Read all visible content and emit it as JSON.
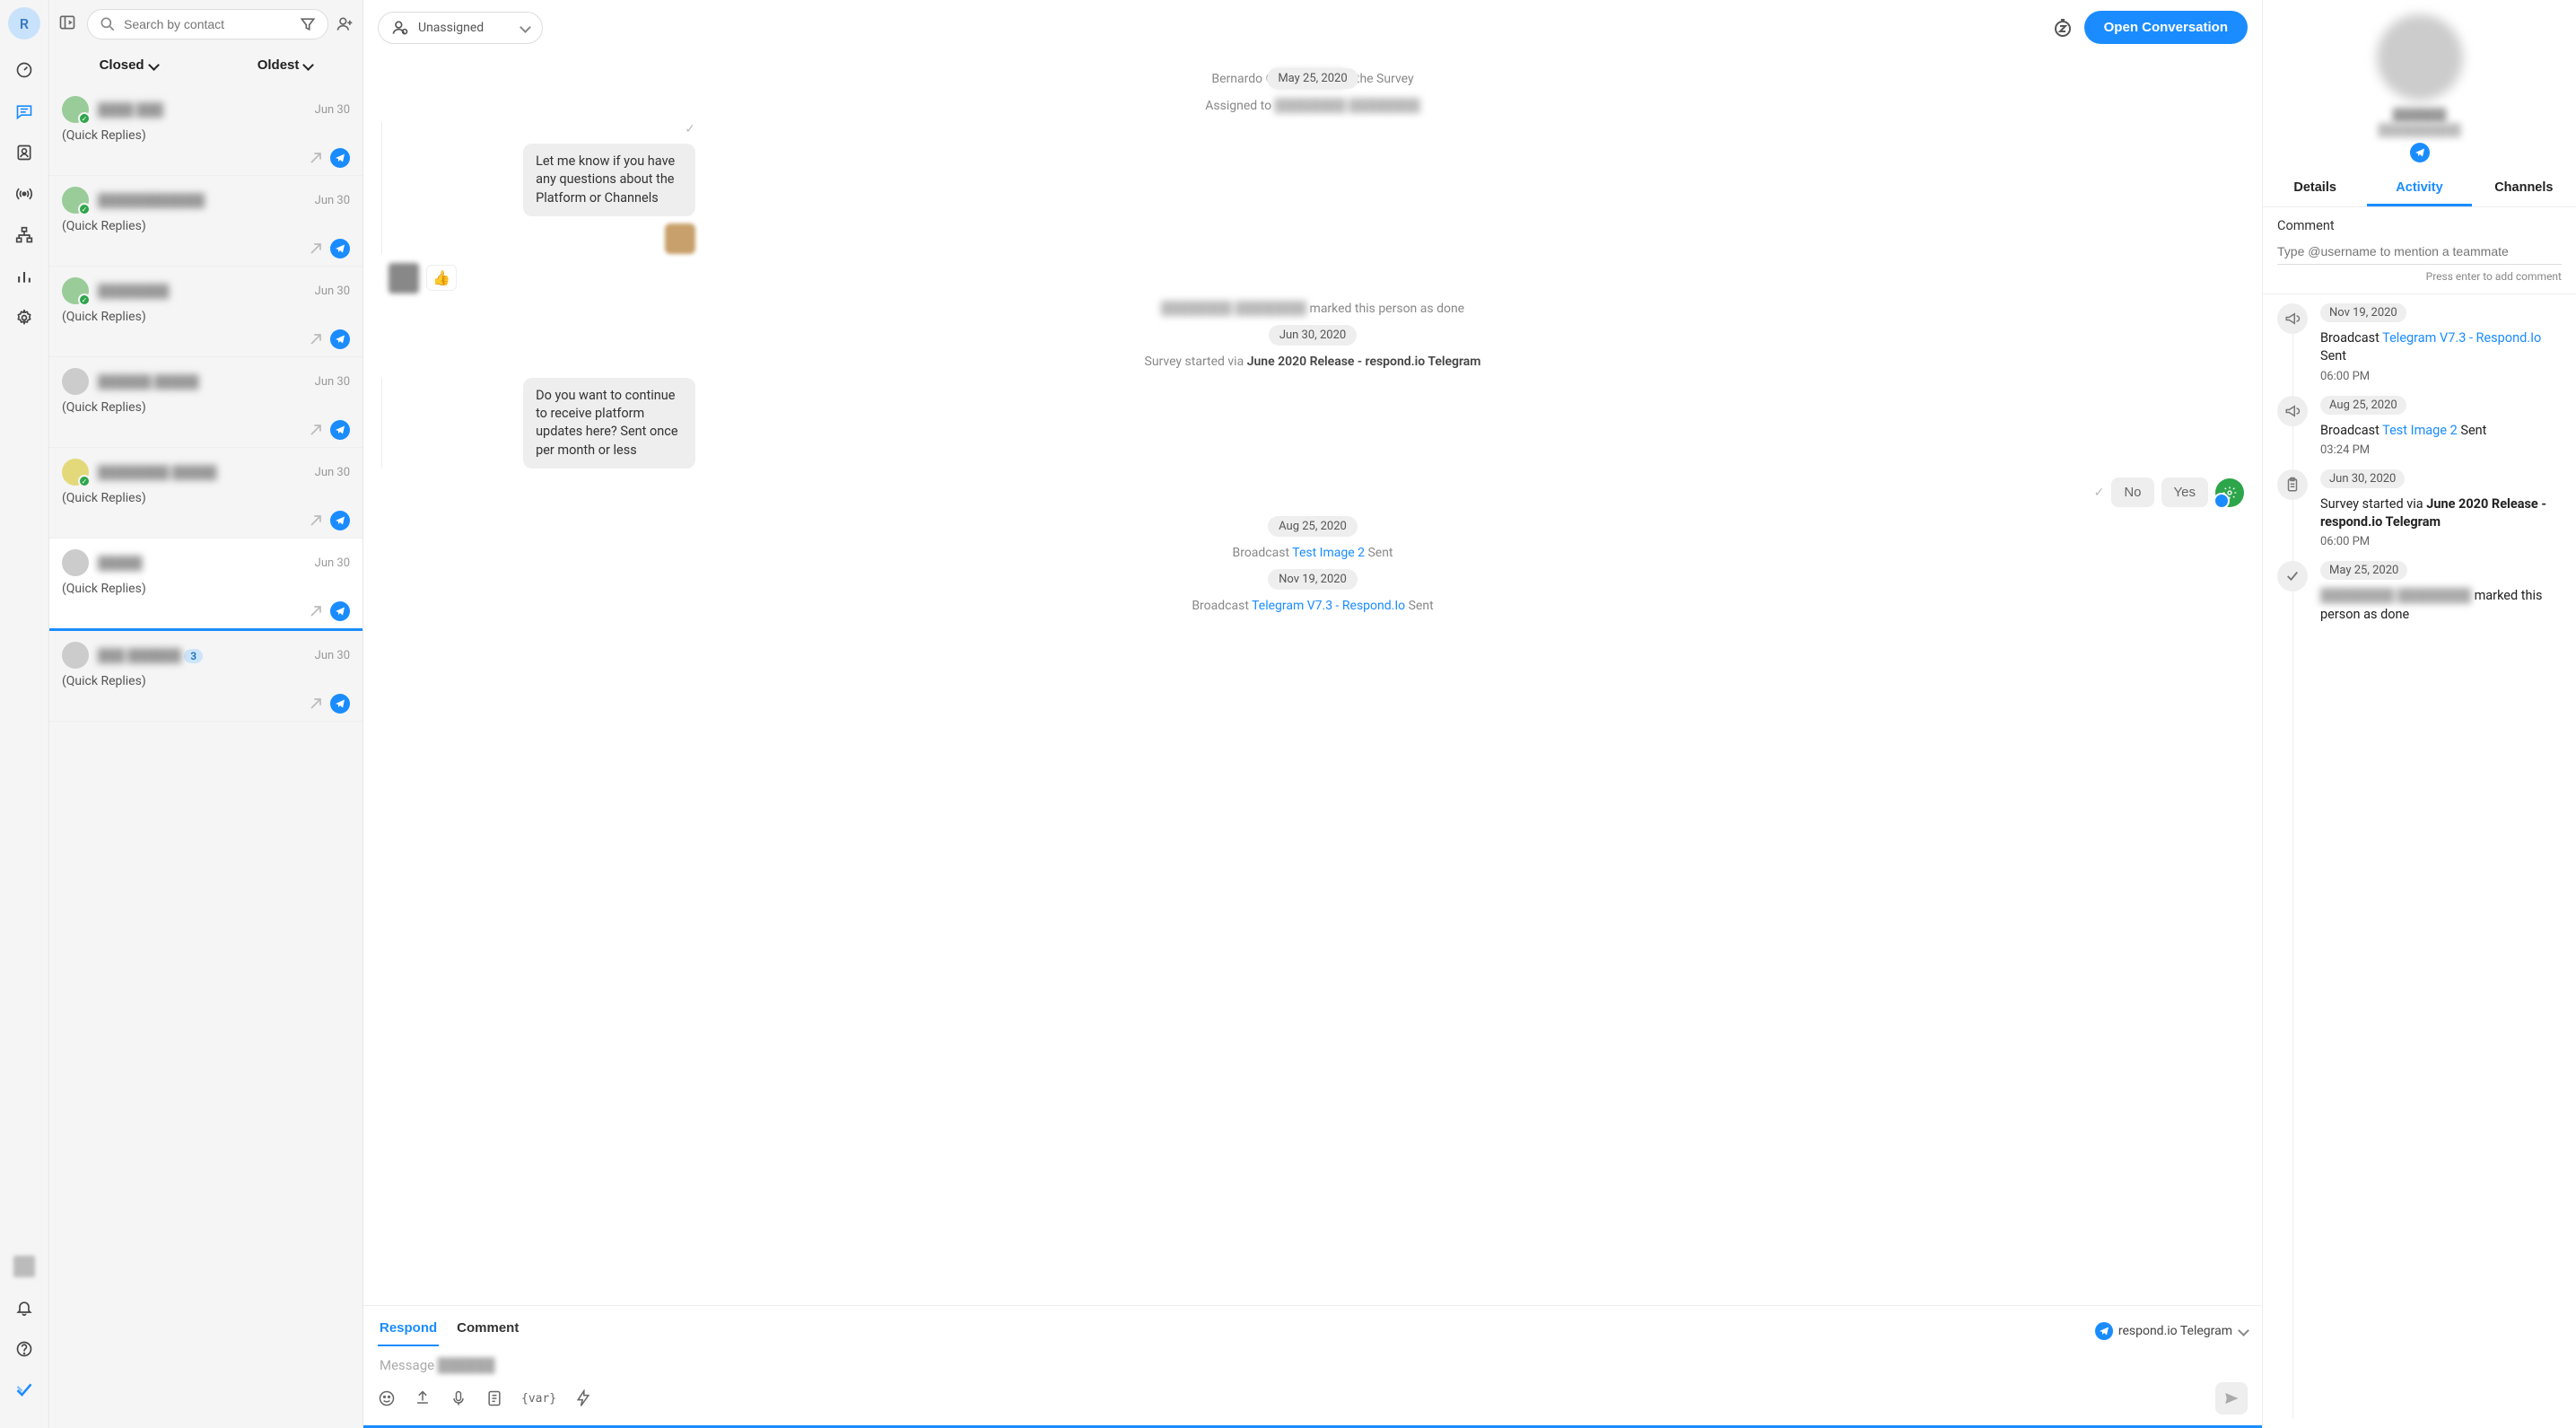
{
  "rail": {
    "initial": "R"
  },
  "search": {
    "placeholder": "Search by contact"
  },
  "filters": {
    "status": "Closed",
    "sort": "Oldest"
  },
  "conversations": [
    {
      "name": "████ ███",
      "date": "Jun 30",
      "preview": "(Quick Replies)"
    },
    {
      "name": "████████████",
      "date": "Jun 30",
      "preview": "(Quick Replies)"
    },
    {
      "name": "████████",
      "date": "Jun 30",
      "preview": "(Quick Replies)"
    },
    {
      "name": "██████ █████",
      "date": "Jun 30",
      "preview": "(Quick Replies)"
    },
    {
      "name": "████████ █████",
      "date": "Jun 30",
      "preview": "(Quick Replies)"
    },
    {
      "name": "█████",
      "date": "Jun 30",
      "preview": "(Quick Replies)",
      "selected": true
    },
    {
      "name": "███ ██████",
      "date": "Jun 30",
      "preview": "(Quick Replies)",
      "unread": "3"
    }
  ],
  "header": {
    "assignee": "Unassigned",
    "open_btn": "Open Conversation"
  },
  "messages": {
    "date1": "May 25, 2020",
    "survey_text_prefix": "Bernardo G",
    "survey_text_suffix": "d the Survey",
    "assigned_prefix": "Assigned to ",
    "assigned_name": "████████ ████████",
    "m1": "Let me know if you have any questions about the Platform or Channels",
    "done_name": "████████ ████████",
    "done_suffix": " marked this person as done",
    "date2": "Jun 30, 2020",
    "survey2_prefix": "Survey started via ",
    "survey2_link": "June 2020 Release - respond.io Telegram",
    "m2": "Do you want to continue to receive platform updates here? Sent once per month or less",
    "qb_no": "No",
    "qb_yes": "Yes",
    "date3": "Aug 25, 2020",
    "bc1_prefix": "Broadcast ",
    "bc1_link": "Test Image 2",
    "bc1_suffix": " Sent",
    "date4": "Nov 19, 2020",
    "bc2_prefix": "Broadcast ",
    "bc2_link": "Telegram V7.3 - Respond.Io",
    "bc2_suffix": " Sent"
  },
  "composer": {
    "tab_respond": "Respond",
    "tab_comment": "Comment",
    "channel": "respond.io Telegram",
    "placeholder_prefix": "Message ",
    "placeholder_name": "██████"
  },
  "profile": {
    "name": "██████",
    "sub": "██████████",
    "tab_details": "Details",
    "tab_activity": "Activity",
    "tab_channels": "Channels"
  },
  "comment": {
    "label": "Comment",
    "placeholder": "Type @username to mention a teammate",
    "hint": "Press enter to add comment"
  },
  "activity": [
    {
      "icon": "megaphone",
      "date": "Nov 19, 2020",
      "text_prefix": "Broadcast ",
      "link": "Telegram V7.3 - Respond.Io",
      "text_suffix": " Sent",
      "time": "06:00 PM"
    },
    {
      "icon": "megaphone",
      "date": "Aug 25, 2020",
      "text_prefix": "Broadcast ",
      "link": "Test Image 2",
      "text_suffix": " Sent",
      "time": "03:24 PM"
    },
    {
      "icon": "clipboard",
      "date": "Jun 30, 2020",
      "text_prefix": "Survey started via ",
      "bold": "June 2020 Release - respond.io Telegram",
      "time": "06:00 PM"
    },
    {
      "icon": "check",
      "date": "May 25, 2020",
      "blurred": "████████ ████████",
      "text_suffix": " marked this person as done"
    }
  ]
}
